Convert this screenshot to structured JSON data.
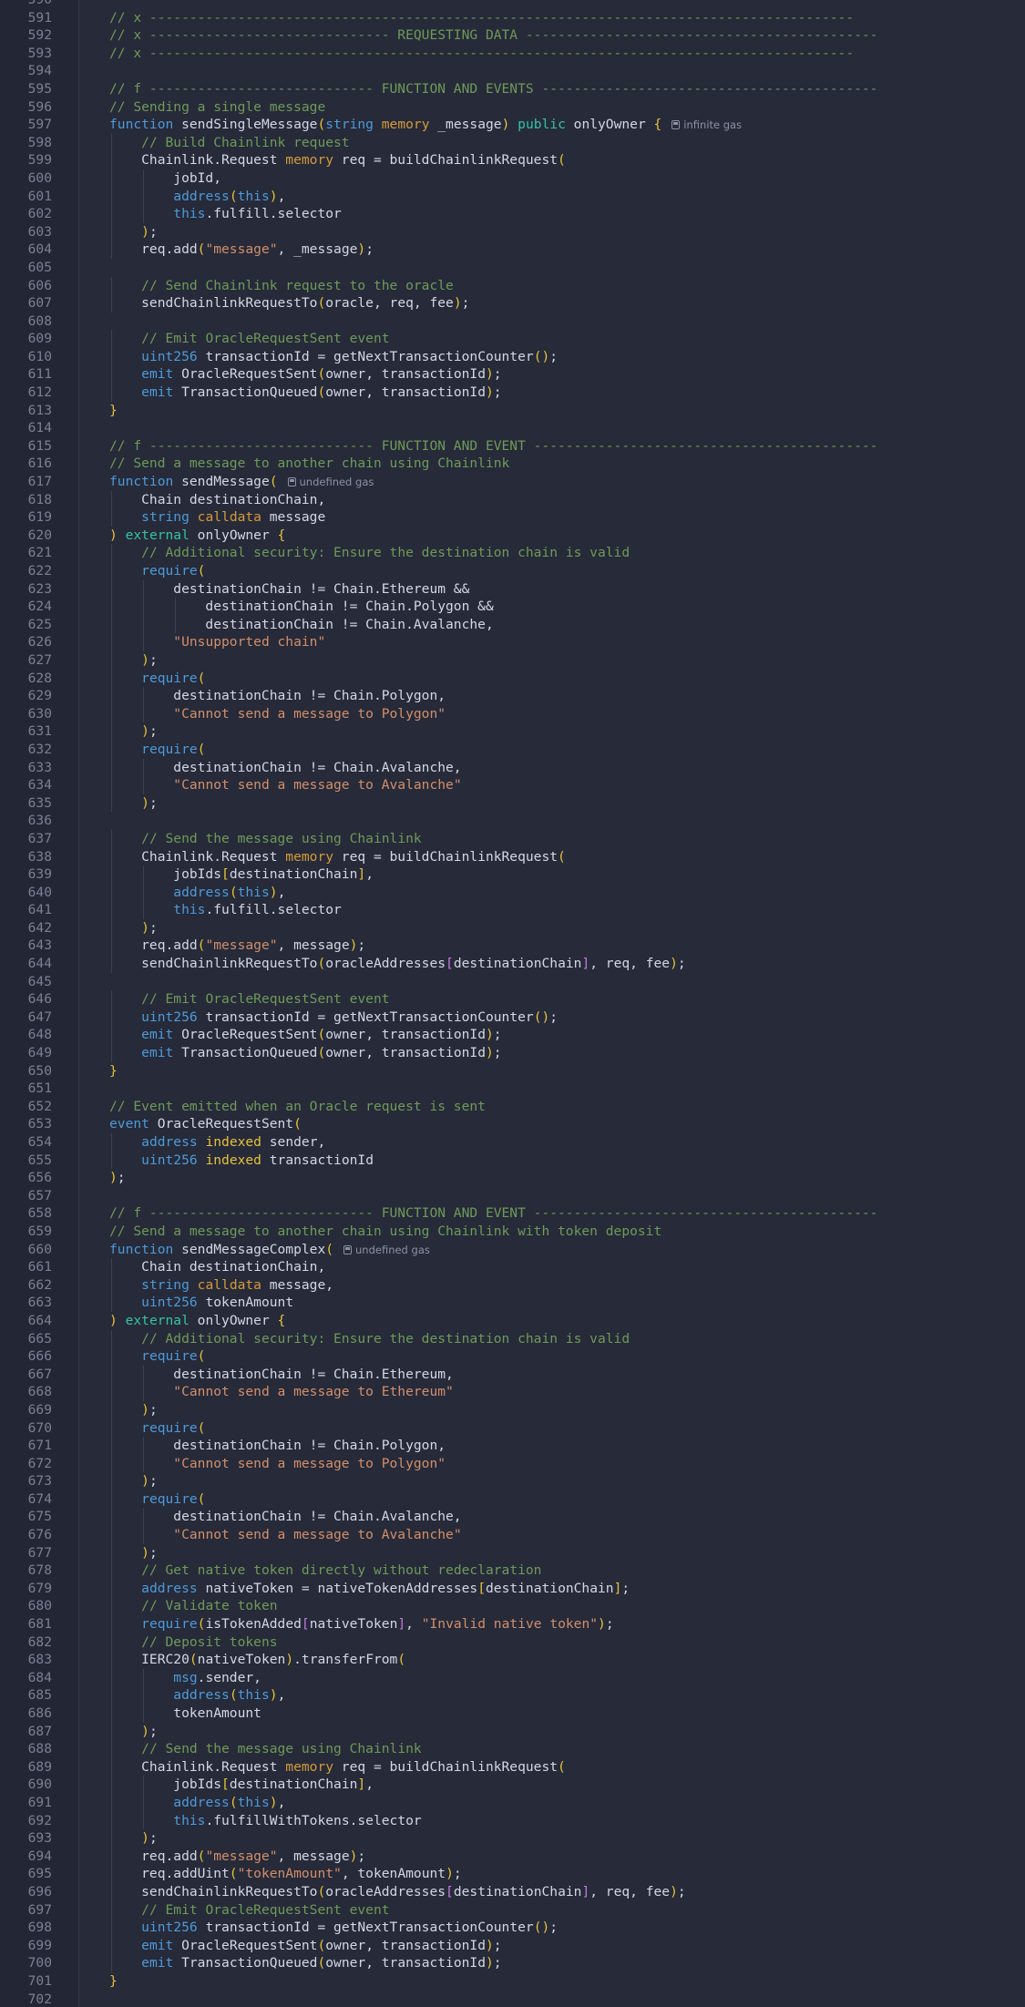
{
  "editor": {
    "first_line": 590,
    "lines": [
      "",
      "// x ----------------------------------------------------------------------------------------",
      "// x ------------------------------ REQUESTING DATA --------------------------------------------",
      "// x ----------------------------------------------------------------------------------------",
      "",
      "// f ---------------------------- FUNCTION AND EVENTS ------------------------------------------",
      "// Sending a single message",
      "function sendSingleMessage(string memory _message) public onlyOwner {",
      "    // Build Chainlink request",
      "    Chainlink.Request memory req = buildChainlinkRequest(",
      "        jobId,",
      "        address(this),",
      "        this.fulfill.selector",
      "    );",
      "    req.add(\"message\", _message);",
      "",
      "    // Send Chainlink request to the oracle",
      "    sendChainlinkRequestTo(oracle, req, fee);",
      "",
      "    // Emit OracleRequestSent event",
      "    uint256 transactionId = getNextTransactionCounter();",
      "    emit OracleRequestSent(owner, transactionId);",
      "    emit TransactionQueued(owner, transactionId);",
      "}",
      "",
      "// f ---------------------------- FUNCTION AND EVENT -------------------------------------------",
      "// Send a message to another chain using Chainlink",
      "function sendMessage(",
      "    Chain destinationChain,",
      "    string calldata message",
      ") external onlyOwner {",
      "    // Additional security: Ensure the destination chain is valid",
      "    require(",
      "        destinationChain != Chain.Ethereum &&",
      "            destinationChain != Chain.Polygon &&",
      "            destinationChain != Chain.Avalanche,",
      "        \"Unsupported chain\"",
      "    );",
      "    require(",
      "        destinationChain != Chain.Polygon,",
      "        \"Cannot send a message to Polygon\"",
      "    );",
      "    require(",
      "        destinationChain != Chain.Avalanche,",
      "        \"Cannot send a message to Avalanche\"",
      "    );",
      "",
      "    // Send the message using Chainlink",
      "    Chainlink.Request memory req = buildChainlinkRequest(",
      "        jobIds[destinationChain],",
      "        address(this),",
      "        this.fulfill.selector",
      "    );",
      "    req.add(\"message\", message);",
      "    sendChainlinkRequestTo(oracleAddresses[destinationChain], req, fee);",
      "",
      "    // Emit OracleRequestSent event",
      "    uint256 transactionId = getNextTransactionCounter();",
      "    emit OracleRequestSent(owner, transactionId);",
      "    emit TransactionQueued(owner, transactionId);",
      "}",
      "",
      "// Event emitted when an Oracle request is sent",
      "event OracleRequestSent(",
      "    address indexed sender,",
      "    uint256 indexed transactionId",
      ");",
      "",
      "// f ---------------------------- FUNCTION AND EVENT -------------------------------------------",
      "// Send a message to another chain using Chainlink with token deposit",
      "function sendMessageComplex(",
      "    Chain destinationChain,",
      "    string calldata message,",
      "    uint256 tokenAmount",
      ") external onlyOwner {",
      "    // Additional security: Ensure the destination chain is valid",
      "    require(",
      "        destinationChain != Chain.Ethereum,",
      "        \"Cannot send a message to Ethereum\"",
      "    );",
      "    require(",
      "        destinationChain != Chain.Polygon,",
      "        \"Cannot send a message to Polygon\"",
      "    );",
      "    require(",
      "        destinationChain != Chain.Avalanche,",
      "        \"Cannot send a message to Avalanche\"",
      "    );",
      "    // Get native token directly without redeclaration",
      "    address nativeToken = nativeTokenAddresses[destinationChain];",
      "    // Validate token",
      "    require(isTokenAdded[nativeToken], \"Invalid native token\");",
      "    // Deposit tokens",
      "    IERC20(nativeToken).transferFrom(",
      "        msg.sender,",
      "        address(this),",
      "        tokenAmount",
      "    );",
      "    // Send the message using Chainlink",
      "    Chainlink.Request memory req = buildChainlinkRequest(",
      "        jobIds[destinationChain],",
      "        address(this),",
      "        this.fulfillWithTokens.selector",
      "    );",
      "    req.add(\"message\", message);",
      "    req.addUint(\"tokenAmount\", tokenAmount);",
      "    sendChainlinkRequestTo(oracleAddresses[destinationChain], req, fee);",
      "    // Emit OracleRequestSent event",
      "    uint256 transactionId = getNextTransactionCounter();",
      "    emit OracleRequestSent(owner, transactionId);",
      "    emit TransactionQueued(owner, transactionId);",
      "}",
      ""
    ],
    "code_lenses": [
      {
        "line": 597,
        "text": "infinite gas"
      },
      {
        "line": 617,
        "text": "undefined gas"
      },
      {
        "line": 660,
        "text": "undefined gas"
      }
    ],
    "colors": {
      "background": "#262a39",
      "gutter": "#232634",
      "comment": "#6f9a58",
      "keyword": "#4f9ad8",
      "data_location": "#d69a3a",
      "string": "#d38f6a"
    }
  }
}
